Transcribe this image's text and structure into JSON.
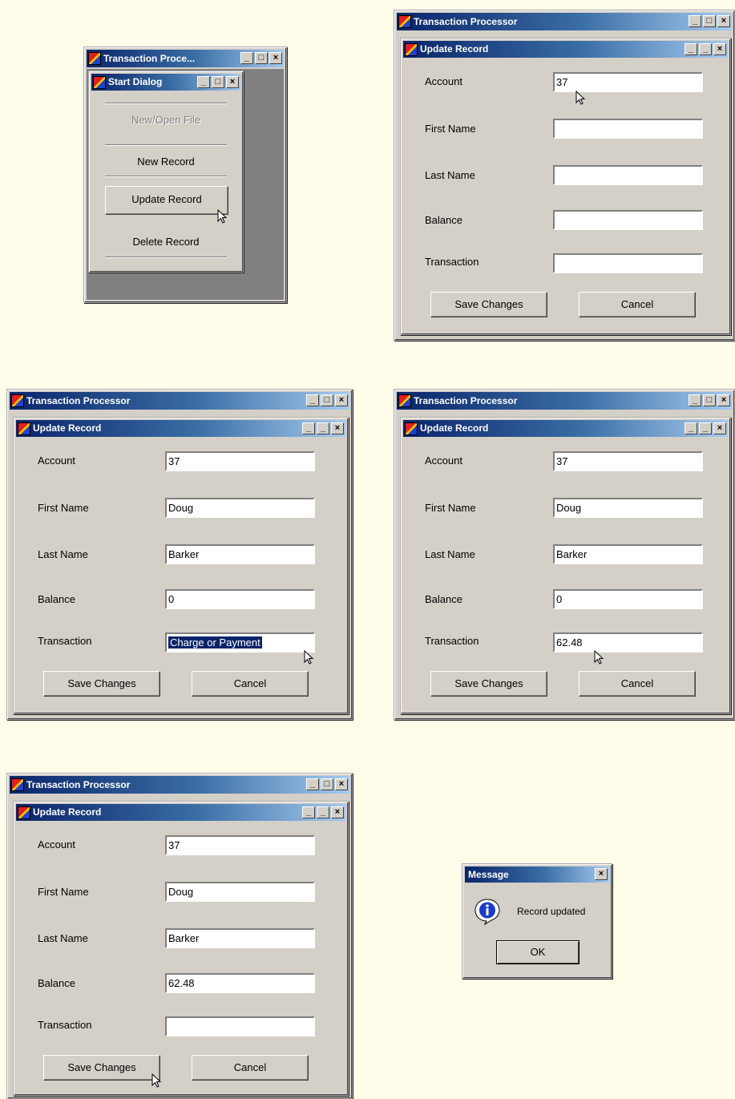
{
  "app_title": "Transaction Processor",
  "app_title_truncated": "Transaction Proce...",
  "start_dialog": {
    "title": "Start Dialog",
    "menu": [
      "New/Open File",
      "New Record",
      "Update Record",
      "Delete Record"
    ]
  },
  "update_form": {
    "title": "Update Record",
    "labels": {
      "account": "Account",
      "first_name": "First Name",
      "last_name": "Last Name",
      "balance": "Balance",
      "transaction": "Transaction"
    },
    "buttons": {
      "save": "Save Changes",
      "cancel": "Cancel"
    }
  },
  "panels": [
    {
      "account": "37",
      "first_name": "",
      "last_name": "",
      "balance": "",
      "transaction": ""
    },
    {
      "account": "37",
      "first_name": "Doug",
      "last_name": "Barker",
      "balance": "0",
      "transaction": "Charge or Payment"
    },
    {
      "account": "37",
      "first_name": "Doug",
      "last_name": "Barker",
      "balance": "0",
      "transaction": "62.48"
    },
    {
      "account": "37",
      "first_name": "Doug",
      "last_name": "Barker",
      "balance": "62.48",
      "transaction": ""
    }
  ],
  "message_box": {
    "title": "Message",
    "message": "Record updated",
    "ok": "OK"
  },
  "icons": {
    "app": "app-icon",
    "info": "info-icon",
    "cursor": "mouse-pointer-icon"
  },
  "colors": {
    "background": "#fffcea",
    "window": "#d4d0c8",
    "titlebar": "#0a246a",
    "selection": "#0a246a"
  }
}
